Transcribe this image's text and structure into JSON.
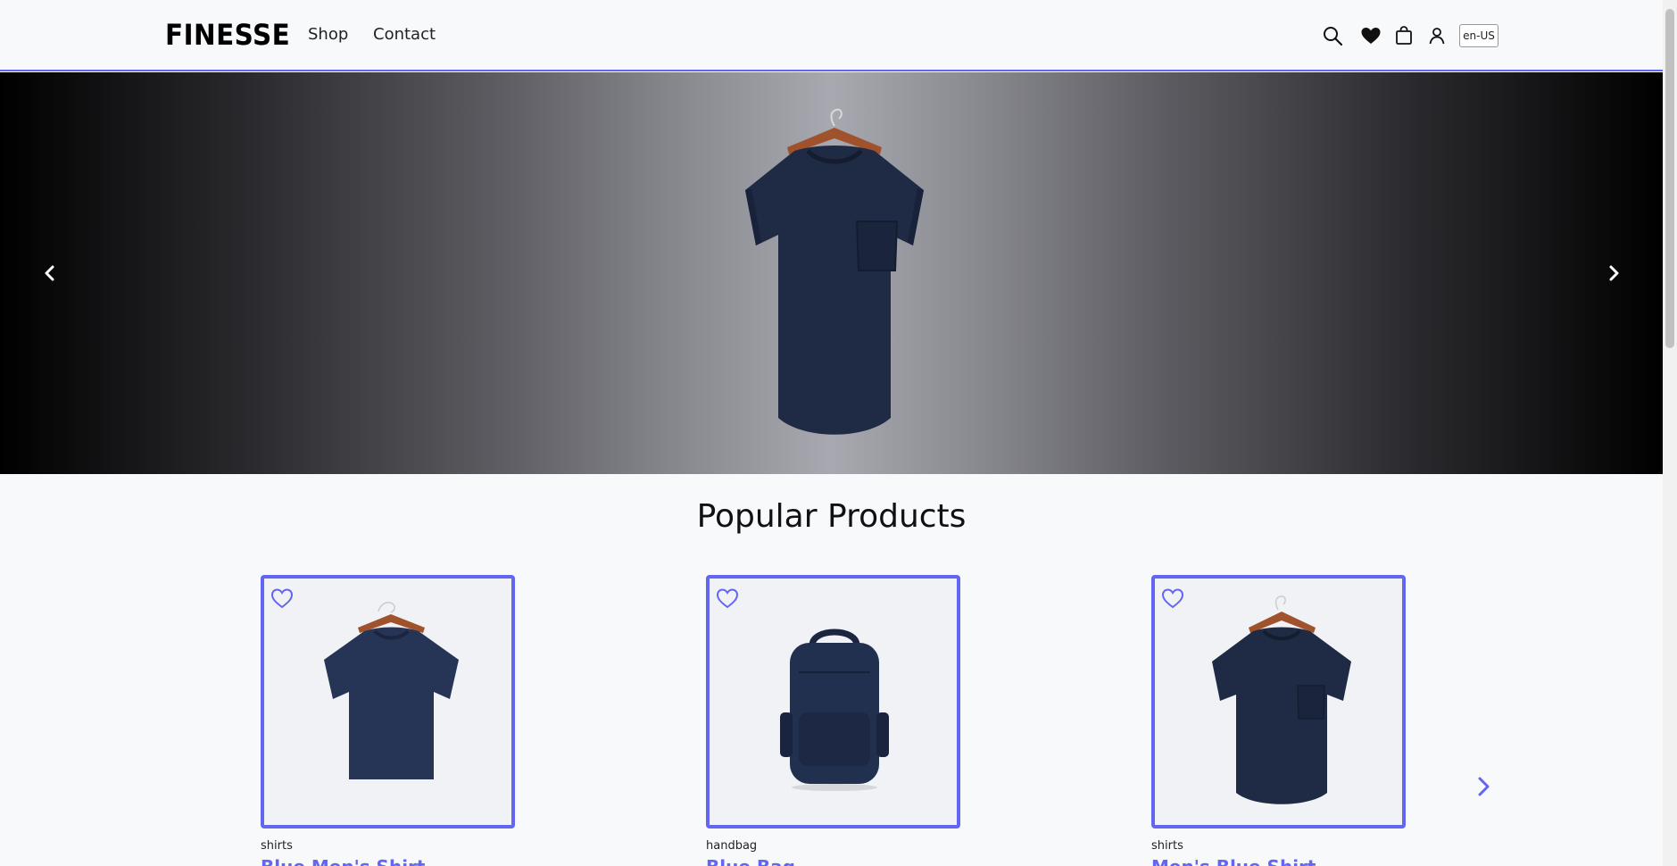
{
  "header": {
    "logo": "FINESSE",
    "nav": [
      {
        "label": "Shop"
      },
      {
        "label": "Contact"
      }
    ],
    "icons": [
      "search-icon",
      "heart-icon",
      "shopping-bag-icon",
      "user-icon"
    ],
    "locale": "en-US"
  },
  "hero": {
    "image": "navy-pocket-t-shirt-on-hanger",
    "prev_icon": "chevron-left-icon",
    "next_icon": "chevron-right-icon"
  },
  "popular": {
    "title": "Popular Products",
    "products": [
      {
        "category": "shirts",
        "name": "Blue Men's Shirt",
        "image": "navy-t-shirt"
      },
      {
        "category": "handbag",
        "name": "Blue Bag",
        "image": "navy-backpack"
      },
      {
        "category": "shirts",
        "name": "Men's Blue Shirt",
        "image": "navy-pocket-t-shirt"
      }
    ],
    "next_icon": "chevron-right-icon"
  },
  "colors": {
    "accent": "#6366f1",
    "background": "#f8f9fb",
    "product_navy": "#1e2a45"
  }
}
